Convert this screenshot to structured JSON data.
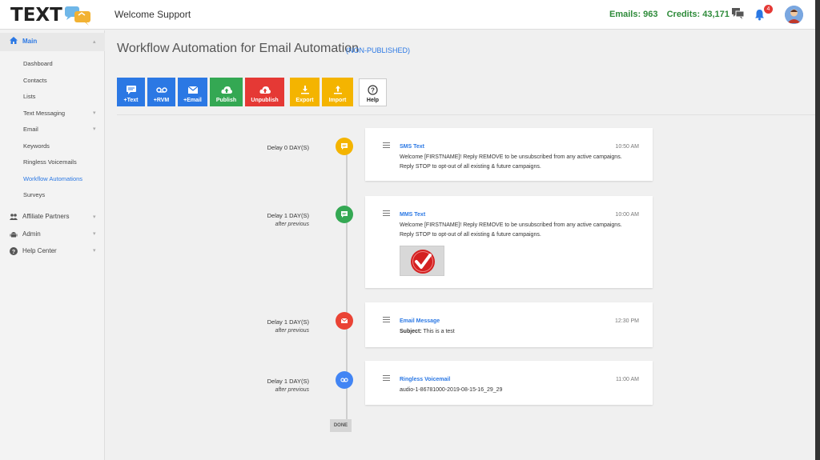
{
  "header": {
    "logo_text": "TEXT",
    "welcome": "Welcome Support",
    "emails": "Emails: 963",
    "credits": "Credits: 43,171",
    "notification_count": "4"
  },
  "sidebar": {
    "main_label": "Main",
    "sub_items": [
      "Dashboard",
      "Contacts",
      "Lists",
      "Text Messaging",
      "Email",
      "Keywords",
      "Ringless Voicemails",
      "Workflow Automations",
      "Surveys"
    ],
    "active_item": "Workflow Automations",
    "sections": [
      "Affiliate Partners",
      "Admin",
      "Help Center"
    ]
  },
  "page": {
    "title": "Workflow Automation for Email Automation",
    "status": "(NON-PUBLISHED)"
  },
  "toolbar": {
    "text": "+Text",
    "rvm": "+RVM",
    "email": "+Email",
    "publish": "Publish",
    "unpublish": "Unpublish",
    "export": "Export",
    "import": "Import",
    "help": "Help"
  },
  "timeline": [
    {
      "delay": "Delay 0 DAY(S)",
      "after": "",
      "type": "SMS Text",
      "time": "10:50 AM",
      "line1": "Welcome [FIRSTNAME]! Reply REMOVE to be unsubscribed from any active campaigns.",
      "line2": "Reply STOP to opt-out of all existing & future campaigns.",
      "color": "#f4b400"
    },
    {
      "delay": "Delay 1 DAY(S)",
      "after": "after previous",
      "type": "MMS Text",
      "time": "10:00 AM",
      "line1": "Welcome [FIRSTNAME]! Reply REMOVE to be unsubscribed from any active campaigns.",
      "line2": "Reply STOP to opt-out of all existing & future campaigns.",
      "color": "#34a853"
    },
    {
      "delay": "Delay 1 DAY(S)",
      "after": "after previous",
      "type": "Email Message",
      "time": "12:30 PM",
      "subject_label": "Subject:",
      "subject": "This is a test",
      "color": "#ea4335"
    },
    {
      "delay": "Delay 1 DAY(S)",
      "after": "after previous",
      "type": "Ringless Voicemail",
      "time": "11:00 AM",
      "line1": "audio-1-86781000-2019-08-15-16_29_29",
      "color": "#4285f4"
    }
  ],
  "done_label": "DONE",
  "colors": {
    "blue": "#2b78e4",
    "green": "#34a853",
    "red": "#ea4335",
    "yellow": "#f4b400",
    "stat_green": "#2e8b3a"
  }
}
